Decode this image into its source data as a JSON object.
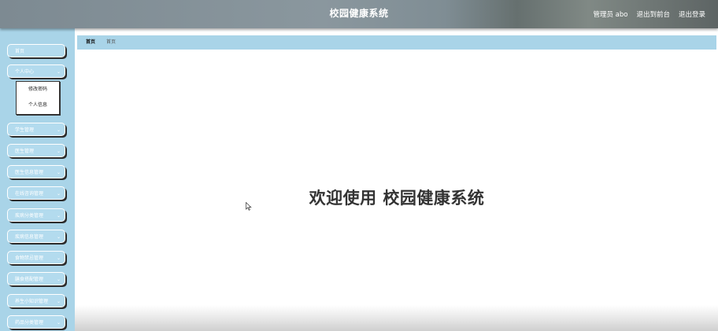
{
  "header": {
    "title": "校园健康系统",
    "user_label": "管理员 abo",
    "back_to_front": "退出到前台",
    "logout": "退出登录"
  },
  "sidebar": {
    "items": [
      {
        "label": "首页"
      },
      {
        "label": "个人中心",
        "expanded": true,
        "children": [
          {
            "label": "修改密码"
          },
          {
            "label": "个人信息"
          }
        ]
      },
      {
        "label": "学生管理"
      },
      {
        "label": "医生管理"
      },
      {
        "label": "医生信息管理"
      },
      {
        "label": "在线咨询管理"
      },
      {
        "label": "疾病分类管理"
      },
      {
        "label": "疾病信息管理"
      },
      {
        "label": "食物禁忌管理"
      },
      {
        "label": "膳食搭配管理"
      },
      {
        "label": "养生小知识管理"
      },
      {
        "label": "药品分类管理"
      }
    ]
  },
  "breadcrumb": {
    "home": "首页",
    "current": "首页"
  },
  "main": {
    "welcome": "欢迎使用 校园健康系统"
  },
  "colors": {
    "sidebar_bg": "#a9d4e8",
    "menu_bg": "#b3dbee",
    "welcome_text": "#333333"
  }
}
